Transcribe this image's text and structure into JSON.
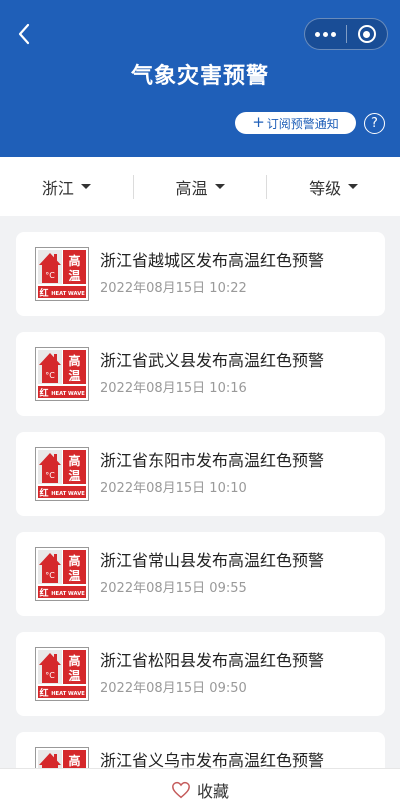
{
  "header": {
    "title": "气象灾害预警",
    "subscribe_label": "订阅预警通知",
    "help_symbol": "?"
  },
  "filters": [
    {
      "label": "浙江"
    },
    {
      "label": "高温"
    },
    {
      "label": "等级"
    }
  ],
  "warning_icon": {
    "text_top": "高",
    "text_mid": "温",
    "level_char": "红",
    "caption": "HEAT WAVE",
    "degree": "°C",
    "color": "#d5282b"
  },
  "alerts": [
    {
      "title": "浙江省越城区发布高温红色预警",
      "time": "2022年08月15日 10:22"
    },
    {
      "title": "浙江省武义县发布高温红色预警",
      "time": "2022年08月15日 10:16"
    },
    {
      "title": "浙江省东阳市发布高温红色预警",
      "time": "2022年08月15日 10:10"
    },
    {
      "title": "浙江省常山县发布高温红色预警",
      "time": "2022年08月15日 09:55"
    },
    {
      "title": "浙江省松阳县发布高温红色预警",
      "time": "2022年08月15日 09:50"
    },
    {
      "title": "浙江省义乌市发布高温红色预警",
      "time": ""
    }
  ],
  "bottom": {
    "favorite_label": "收藏"
  },
  "colors": {
    "header_bg": "#1f5fb8",
    "background": "#f1f2f4"
  }
}
